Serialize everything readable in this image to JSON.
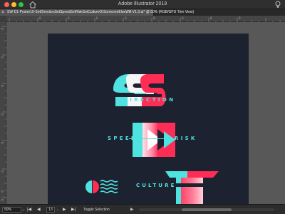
{
  "app": {
    "title": "Adobe Illustrator 2019"
  },
  "document": {
    "tab_close": "×",
    "tab_title": "SW-D1-Poster10-SetDirectionSetSpeedSetRiskSetCultureOrSomeoneElseWill-V1.0.ai* @ 50% (RGB/GPU Trim View)"
  },
  "rulers": {
    "top": [
      "0",
      "0",
      "0",
      "0",
      "0",
      "0",
      "0",
      "0"
    ],
    "left": [
      "0",
      "0",
      "0",
      "0",
      "0",
      "0",
      "0",
      "0"
    ]
  },
  "artwork": {
    "words": {
      "direction": "DIRECTION",
      "speed": "SPEED",
      "risk": "RISK",
      "culture": "CULTURE"
    },
    "colors": {
      "background": "#1d2230",
      "cyan": "#4ee3e0",
      "red": "#ff2d55",
      "pink": "#ff8aa8",
      "canvas": "#585858"
    }
  },
  "status": {
    "zoom": "50%",
    "first_page": "|◀",
    "prev_page": "◀",
    "page": "13",
    "next_page": "▶",
    "last_page": "▶|",
    "label": "Toggle Selection",
    "arrow": "▶"
  }
}
